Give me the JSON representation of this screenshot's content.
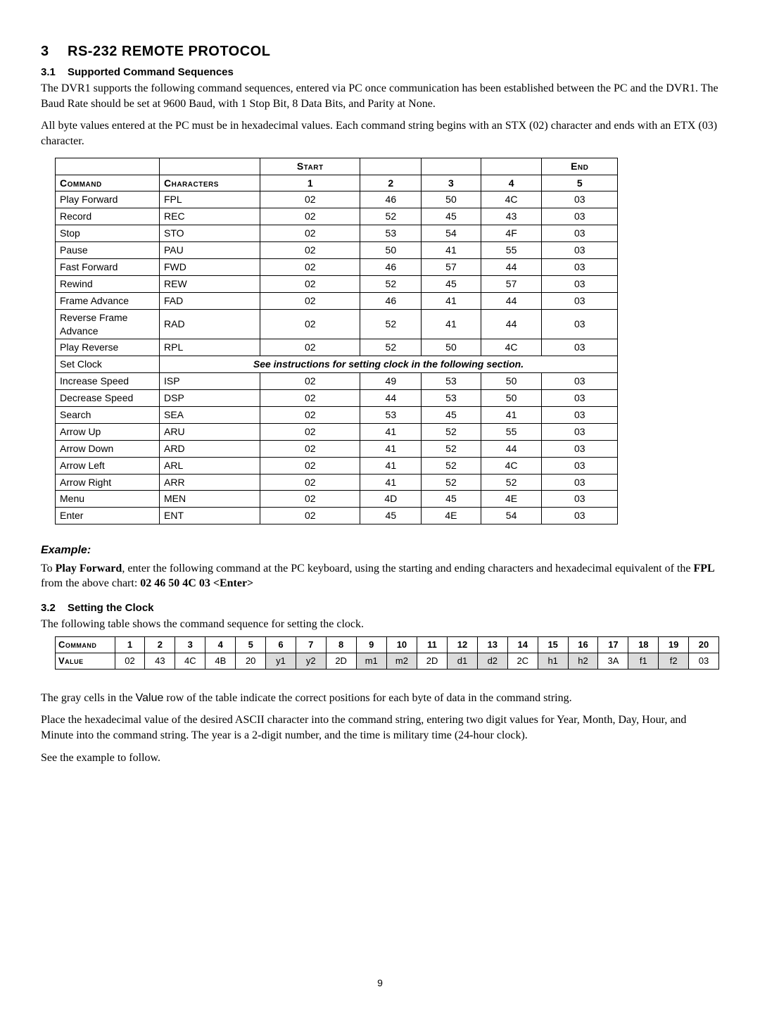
{
  "section": {
    "number": "3",
    "title": "RS-232 REMOTE PROTOCOL",
    "sub1": {
      "number": "3.1",
      "title": "Supported Command Sequences"
    },
    "sub2": {
      "number": "3.2",
      "title": "Setting the Clock"
    }
  },
  "para": {
    "intro1_a": "The DVR1 supports the following command sequences, entered via PC once communication has been established between the PC and the DVR1. The Baud Rate should be set at 9600 Baud, with 1 Stop Bit, 8 Data Bits, and Parity at None.",
    "intro2": "All byte values entered at the PC must be in hexadecimal values. Each command string begins with an STX (02) character and ends with an ETX (03) character.",
    "example_label": "Example:",
    "example_pre": "To ",
    "example_bold1": "Play Forward",
    "example_mid": ", enter the following command at the PC keyboard, using the starting and ending characters and hexadecimal equivalent of the ",
    "example_bold2": "FPL",
    "example_mid2": " from the above chart:  ",
    "example_bold3": "02 46 50 4C 03 <Enter>",
    "clock_intro": "The following table shows the command sequence for setting the clock.",
    "gray_note_a": "The gray cells in the ",
    "gray_note_word": "Value",
    "gray_note_b": " row of the table indicate the correct positions for each byte of data in the command string.",
    "place_hex": "Place the hexadecimal value of the desired ASCII character into the command string, entering two digit values for Year, Month, Day, Hour, and Minute into the command string. The year is a 2-digit number, and the time is military time (24-hour clock).",
    "see_example": "See the example to follow."
  },
  "cmd_table": {
    "super": {
      "start": "Start",
      "end": "End"
    },
    "headers": {
      "command": "Command",
      "characters": "Characters",
      "c1": "1",
      "c2": "2",
      "c3": "3",
      "c4": "4",
      "c5": "5"
    },
    "setclock_note": "See instructions for setting clock in the following section.",
    "rows": [
      {
        "command": "Play Forward",
        "chars": "FPL",
        "v": [
          "02",
          "46",
          "50",
          "4C",
          "03"
        ]
      },
      {
        "command": "Record",
        "chars": "REC",
        "v": [
          "02",
          "52",
          "45",
          "43",
          "03"
        ]
      },
      {
        "command": "Stop",
        "chars": "STO",
        "v": [
          "02",
          "53",
          "54",
          "4F",
          "03"
        ]
      },
      {
        "command": "Pause",
        "chars": "PAU",
        "v": [
          "02",
          "50",
          "41",
          "55",
          "03"
        ]
      },
      {
        "command": "Fast Forward",
        "chars": "FWD",
        "v": [
          "02",
          "46",
          "57",
          "44",
          "03"
        ]
      },
      {
        "command": "Rewind",
        "chars": "REW",
        "v": [
          "02",
          "52",
          "45",
          "57",
          "03"
        ]
      },
      {
        "command": "Frame Advance",
        "chars": "FAD",
        "v": [
          "02",
          "46",
          "41",
          "44",
          "03"
        ]
      },
      {
        "command": "Reverse Frame Advance",
        "chars": "RAD",
        "v": [
          "02",
          "52",
          "41",
          "44",
          "03"
        ]
      },
      {
        "command": "Play Reverse",
        "chars": "RPL",
        "v": [
          "02",
          "52",
          "50",
          "4C",
          "03"
        ]
      },
      {
        "command": "Set Clock",
        "special": true
      },
      {
        "command": "Increase Speed",
        "chars": "ISP",
        "v": [
          "02",
          "49",
          "53",
          "50",
          "03"
        ]
      },
      {
        "command": "Decrease Speed",
        "chars": "DSP",
        "v": [
          "02",
          "44",
          "53",
          "50",
          "03"
        ]
      },
      {
        "command": "Search",
        "chars": "SEA",
        "v": [
          "02",
          "53",
          "45",
          "41",
          "03"
        ]
      },
      {
        "command": "Arrow Up",
        "chars": "ARU",
        "v": [
          "02",
          "41",
          "52",
          "55",
          "03"
        ]
      },
      {
        "command": "Arrow Down",
        "chars": "ARD",
        "v": [
          "02",
          "41",
          "52",
          "44",
          "03"
        ]
      },
      {
        "command": "Arrow Left",
        "chars": "ARL",
        "v": [
          "02",
          "41",
          "52",
          "4C",
          "03"
        ]
      },
      {
        "command": "Arrow Right",
        "chars": "ARR",
        "v": [
          "02",
          "41",
          "52",
          "52",
          "03"
        ]
      },
      {
        "command": "Menu",
        "chars": "MEN",
        "v": [
          "02",
          "4D",
          "45",
          "4E",
          "03"
        ]
      },
      {
        "command": "Enter",
        "chars": "ENT",
        "v": [
          "02",
          "45",
          "4E",
          "54",
          "03"
        ]
      }
    ]
  },
  "clock_table": {
    "row1_label": "Command",
    "row2_label": "Value",
    "cols": [
      "1",
      "2",
      "3",
      "4",
      "5",
      "6",
      "7",
      "8",
      "9",
      "10",
      "11",
      "12",
      "13",
      "14",
      "15",
      "16",
      "17",
      "18",
      "19",
      "20"
    ],
    "vals": [
      "02",
      "43",
      "4C",
      "4B",
      "20",
      "y1",
      "y2",
      "2D",
      "m1",
      "m2",
      "2D",
      "d1",
      "d2",
      "2C",
      "h1",
      "h2",
      "3A",
      "f1",
      "f2",
      "03"
    ],
    "gray": [
      5,
      6,
      8,
      9,
      11,
      12,
      14,
      15,
      17,
      18
    ]
  },
  "page_number": "9"
}
